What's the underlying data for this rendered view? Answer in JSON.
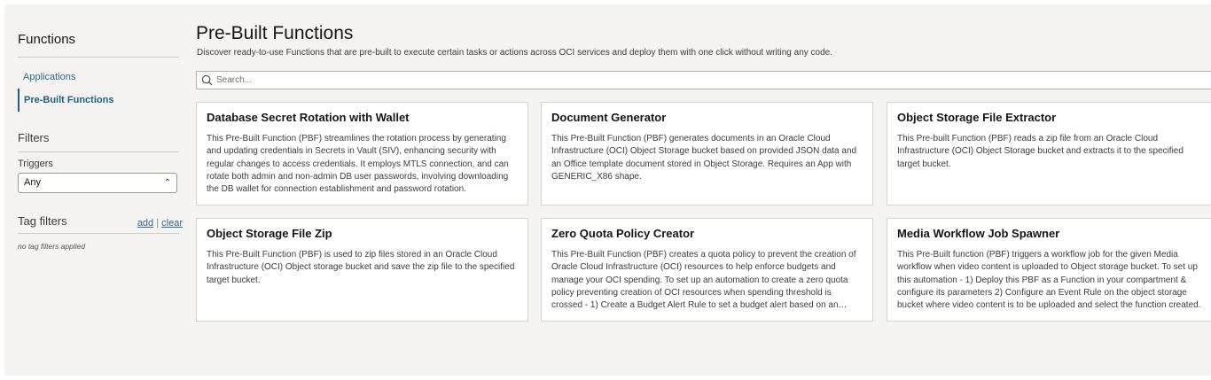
{
  "sidebar": {
    "title": "Functions",
    "nav": [
      {
        "label": "Applications"
      },
      {
        "label": "Pre-Built Functions"
      }
    ],
    "filters_title": "Filters",
    "triggers_label": "Triggers",
    "triggers_value": "Any",
    "tag_filters_title": "Tag filters",
    "tag_add": "add",
    "tag_separator": "|",
    "tag_clear": "clear",
    "no_tags": "no tag filters applied"
  },
  "main": {
    "title": "Pre-Built Functions",
    "description": "Discover ready-to-use Functions that are pre-built to execute certain tasks or actions across OCI services and deploy them with one click without writing any code.",
    "search_placeholder": "Search...",
    "cards": [
      {
        "title": "Database Secret Rotation with Wallet",
        "description": "This Pre-Built Function (PBF) streamlines the rotation process by generating and updating credentials in Secrets in Vault (SIV), enhancing security with regular changes to access credentials. It employs MTLS connection, and can rotate both admin and non-admin DB user passwords, involving downloading the DB wallet for connection establishment and password rotation."
      },
      {
        "title": "Document Generator",
        "description": "This Pre-Built Function (PBF) generates documents in an Oracle Cloud Infrastructure (OCI) Object Storage bucket based on provided JSON data and an Office template document stored in Object Storage. Requires an App with GENERIC_X86 shape."
      },
      {
        "title": "Object Storage File Extractor",
        "description": "This Pre-built Function (PBF) reads a zip file from an Oracle Cloud Infrastructure (OCI) Object Storage bucket and extracts it to the specified target bucket."
      },
      {
        "title": "Object Storage File Zip",
        "description": "This Pre-Built Function (PBF) is used to zip files stored in an Oracle Cloud Infrastructure (OCI) Object storage bucket and save the zip file to the specified target bucket."
      },
      {
        "title": "Zero Quota Policy Creator",
        "description": "This Pre-Built Function (PBF) creates a quota policy to prevent the creation of Oracle Cloud Infrastructure (OCI) resources to help enforce budgets and manage your OCI spending. To set up an automation to create a zero quota policy preventing creation of OCI resources when spending threshold is crossed - 1) Create a Budget Alert Rule to set a budget alert based on an amount."
      },
      {
        "title": "Media Workflow Job Spawner",
        "description": "This Pre-Built function (PBF) triggers a workflow job for the given Media workflow when video content is uploaded to Object storage bucket. To set up this automation - 1) Deploy this PBF as a Function in your compartment & configure its parameters 2) Configure an Event Rule on the object storage bucket where video content is to be uploaded and select the function created."
      }
    ]
  },
  "colors": {
    "background": "#f5f4f2",
    "link": "#2d6a8e",
    "active_nav": "#1f5f82"
  }
}
